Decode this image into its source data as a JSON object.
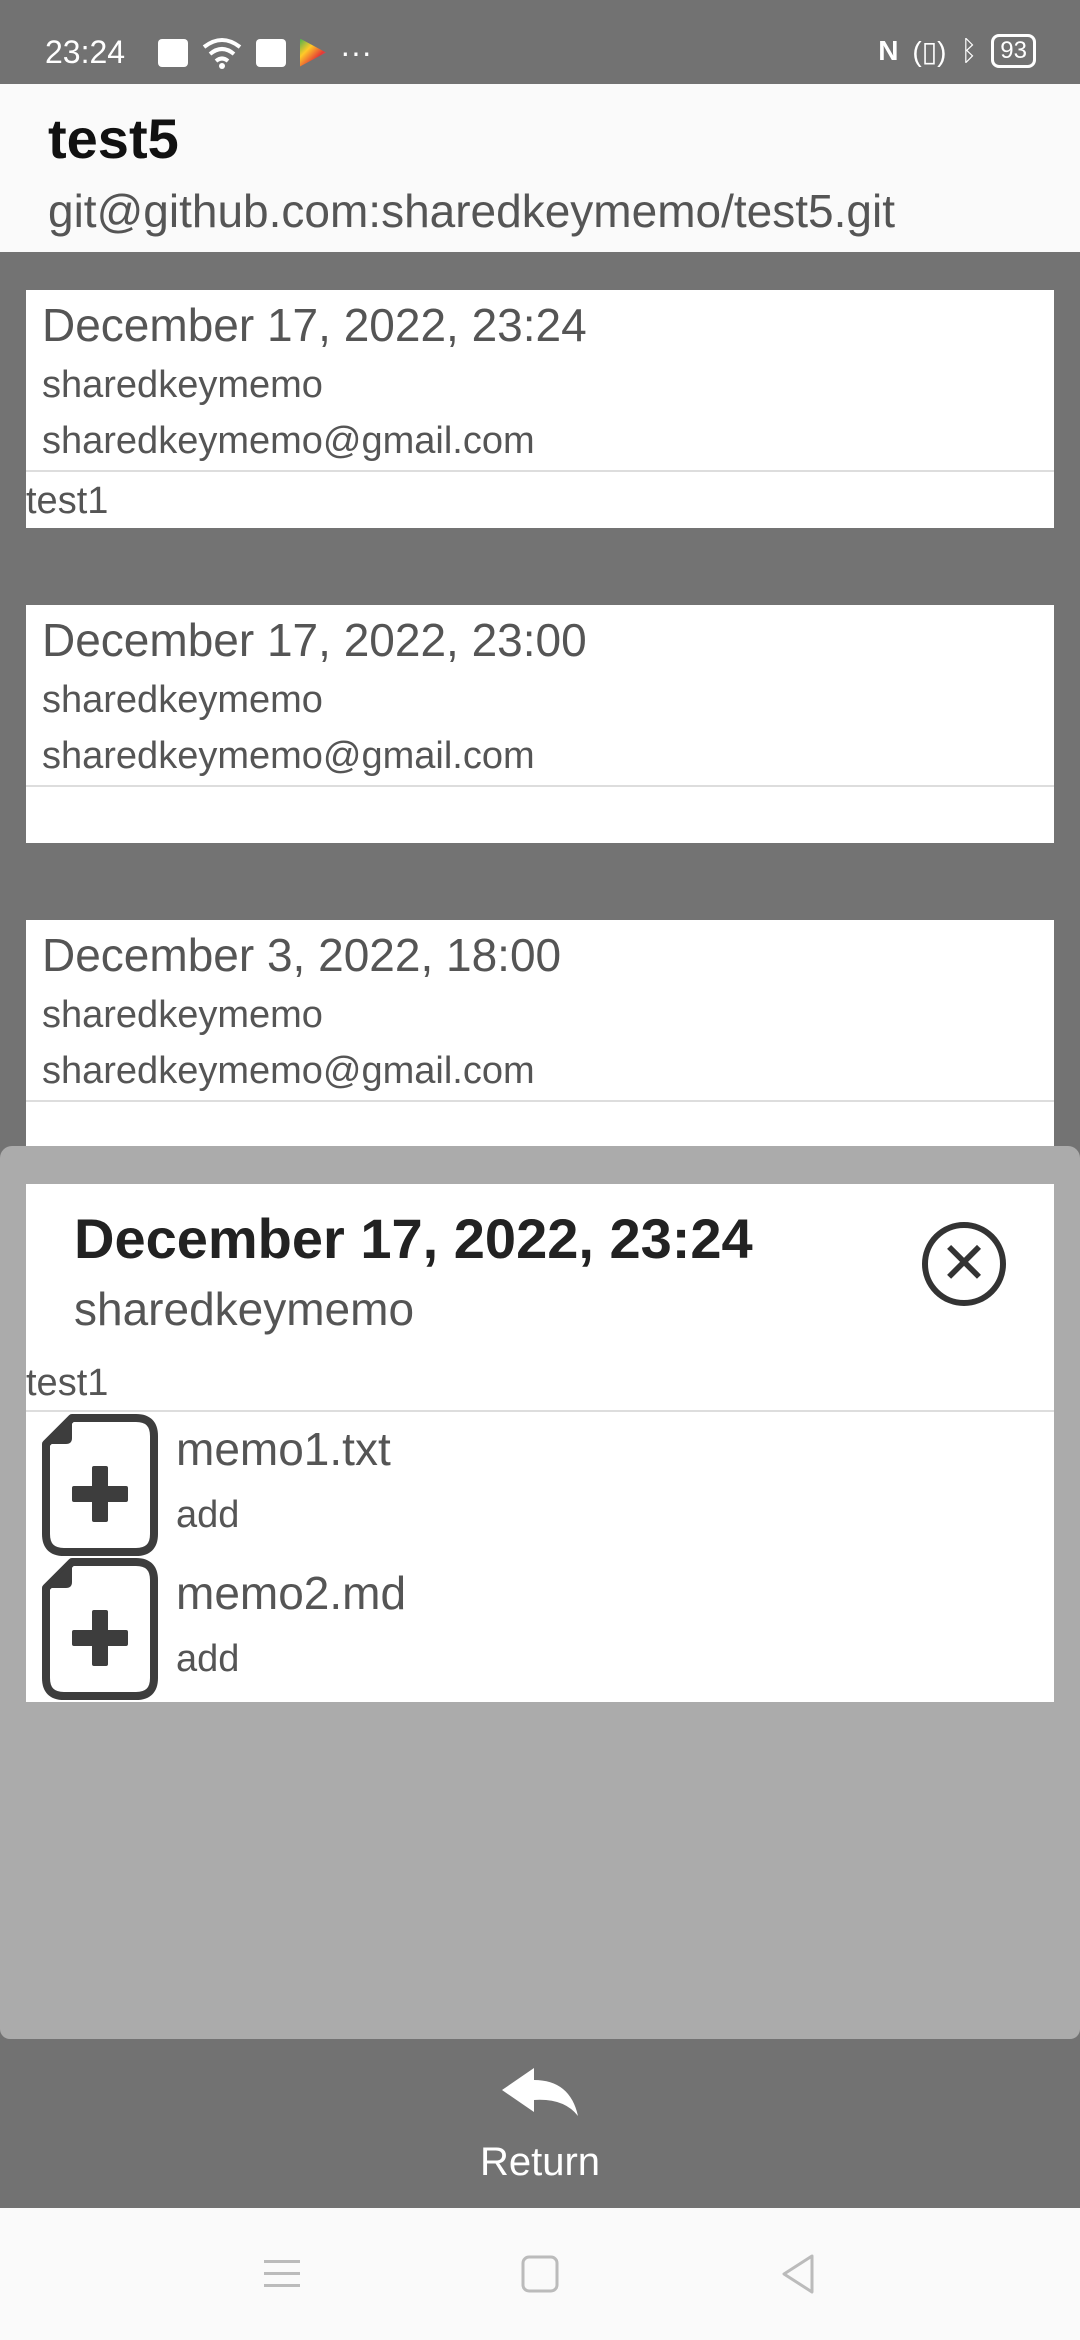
{
  "status_bar": {
    "time": "23:24",
    "overflow": "···",
    "battery": "93",
    "icons_left": [
      "notification-x-icon",
      "wifi-icon",
      "gmail-icon",
      "play-store-icon"
    ],
    "icons_right": [
      "nfc-icon",
      "vibrate-icon",
      "bluetooth-icon",
      "battery-icon"
    ]
  },
  "header": {
    "title": "test5",
    "url": "git@github.com:sharedkeymemo/test5.git"
  },
  "commits": [
    {
      "date": "December 17, 2022, 23:24",
      "author": "sharedkeymemo",
      "email": "sharedkeymemo@gmail.com",
      "message": "test1"
    },
    {
      "date": "December 17, 2022, 23:00",
      "author": "sharedkeymemo",
      "email": "sharedkeymemo@gmail.com",
      "message": ""
    },
    {
      "date": "December 3, 2022, 18:00",
      "author": "sharedkeymemo",
      "email": "sharedkeymemo@gmail.com",
      "message": ""
    }
  ],
  "detail": {
    "title": "December 17, 2022, 23:24",
    "author": "sharedkeymemo",
    "message": "test1",
    "files": [
      {
        "name": "memo1.txt",
        "action": "add"
      },
      {
        "name": "memo2.md",
        "action": "add"
      }
    ]
  },
  "bottom": {
    "return_label": "Return"
  },
  "colors": {
    "dim_background": "#737373",
    "overlay": "#ababab",
    "card": "#ffffff",
    "icon_dark": "#3d3d3d"
  }
}
